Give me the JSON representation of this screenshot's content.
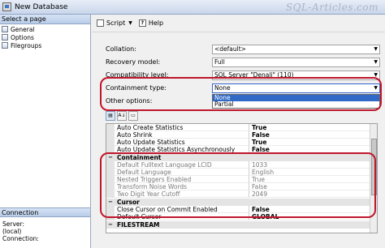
{
  "window": {
    "title": "New Database",
    "watermark": "SQL-Articles.com"
  },
  "left_pane": {
    "header": "Select a page",
    "pages": [
      {
        "label": "General",
        "icon": "page-icon"
      },
      {
        "label": "Options",
        "icon": "page-icon"
      },
      {
        "label": "Filegroups",
        "icon": "page-icon"
      }
    ],
    "connection_header": "Connection",
    "connection_lines": [
      "Server:",
      "(local)",
      "Connection:"
    ]
  },
  "toolbar": {
    "script_label": "Script",
    "help_label": "Help"
  },
  "form": {
    "collation": {
      "label": "Collation:",
      "value": "<default>"
    },
    "recovery": {
      "label": "Recovery model:",
      "value": "Full"
    },
    "compat": {
      "label": "Compatibility level:",
      "value": "SQL Server \"Denali\" (110)"
    },
    "containment": {
      "label": "Containment type:",
      "value": "None",
      "options": [
        "None",
        "Partial"
      ]
    },
    "other_label": "Other options:"
  },
  "property_grid": {
    "rows": [
      {
        "name": "Auto Create Statistics",
        "value": "True"
      },
      {
        "name": "Auto Shrink",
        "value": "False"
      },
      {
        "name": "Auto Update Statistics",
        "value": "True"
      },
      {
        "name": "Auto Update Statistics Asynchronously",
        "value": "False"
      }
    ],
    "containment_category": "Containment",
    "containment_rows": [
      {
        "name": "Default Fulltext Language LCID",
        "value": "1033"
      },
      {
        "name": "Default Language",
        "value": "English"
      },
      {
        "name": "Nested Triggers Enabled",
        "value": "True"
      },
      {
        "name": "Transform Noise Words",
        "value": "False"
      },
      {
        "name": "Two Digit Year Cutoff",
        "value": "2049"
      }
    ],
    "cursor_category": "Cursor",
    "cursor_rows": [
      {
        "name": "Close Cursor on Commit Enabled",
        "value": "False"
      },
      {
        "name": "Default Cursor",
        "value": "GLOBAL"
      }
    ],
    "filestream_category": "FILESTREAM"
  },
  "colors": {
    "highlight": "#c0152a",
    "selection": "#3169c6"
  }
}
